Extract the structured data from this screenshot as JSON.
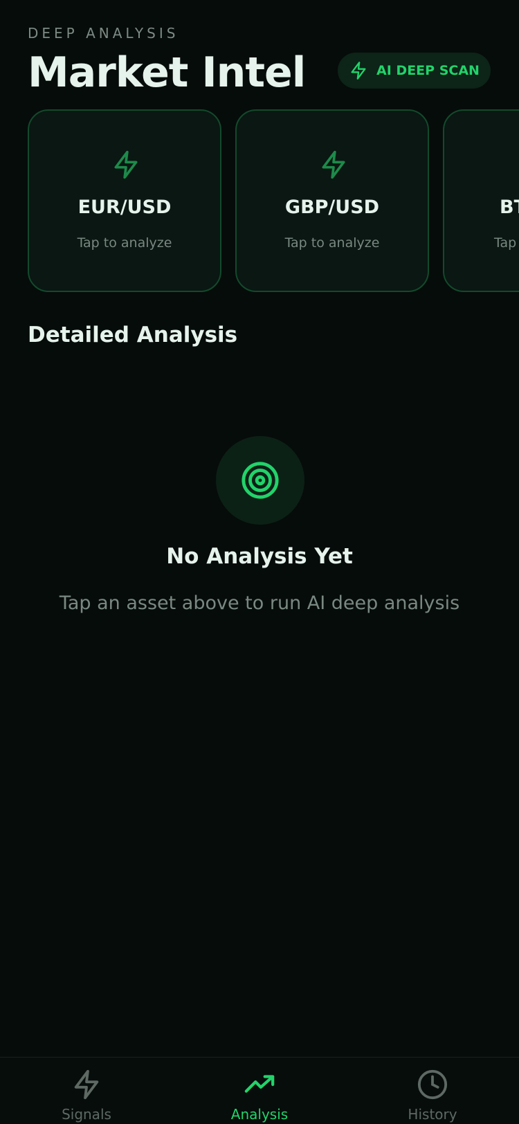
{
  "header": {
    "eyebrow": "DEEP ANALYSIS",
    "title": "Market Intel",
    "scan_button": "AI DEEP SCAN"
  },
  "assets": [
    {
      "symbol": "EUR/USD",
      "hint": "Tap to analyze",
      "icon": "bolt-icon"
    },
    {
      "symbol": "GBP/USD",
      "hint": "Tap to analyze",
      "icon": "bolt-icon"
    },
    {
      "symbol": "BT",
      "hint": "Tap",
      "icon": "bolt-icon"
    }
  ],
  "section": {
    "title": "Detailed Analysis"
  },
  "empty_state": {
    "icon": "target-icon",
    "title": "No Analysis Yet",
    "subtitle": "Tap an asset above to run AI deep analysis"
  },
  "tabbar": {
    "tabs": [
      {
        "label": "Signals",
        "icon": "bolt-icon",
        "active": false
      },
      {
        "label": "Analysis",
        "icon": "trending-up-icon",
        "active": true
      },
      {
        "label": "History",
        "icon": "clock-icon",
        "active": false
      }
    ]
  },
  "colors": {
    "background": "#060c0a",
    "accent": "#22d36a",
    "card_border": "#134a2c",
    "muted_text": "#7a8882"
  }
}
